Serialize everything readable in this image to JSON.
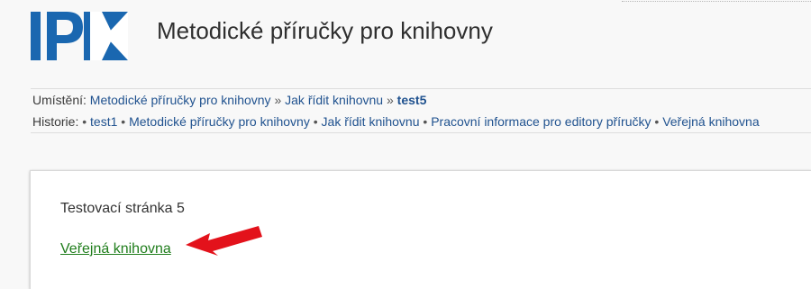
{
  "header": {
    "site_title": "Metodické příručky pro knihovny",
    "logo_text": "IPK",
    "logo_colors": {
      "primary": "#1a67b0",
      "accent": "#ffffff"
    }
  },
  "location": {
    "label": "Umístění:",
    "items": [
      "Metodické příručky pro knihovny",
      "Jak řídit knihovnu",
      "test5"
    ],
    "separator": "»"
  },
  "history": {
    "label": "Historie:",
    "items": [
      "test1",
      "Metodické příručky pro knihovny",
      "Jak řídit knihovnu",
      "Pracovní informace pro editory příručky",
      "Veřejná knihovna"
    ],
    "separator": "•"
  },
  "content": {
    "heading": "Testovací stránka 5",
    "link_label": "Veřejná knihovna"
  },
  "annotation": {
    "arrow_icon": "red-arrow-icon",
    "color": "#e3121b"
  },
  "colors": {
    "breadcrumb_link": "#20528f",
    "content_link": "#1f7d1b",
    "background": "#f8f8f8",
    "card_background": "#ffffff"
  }
}
